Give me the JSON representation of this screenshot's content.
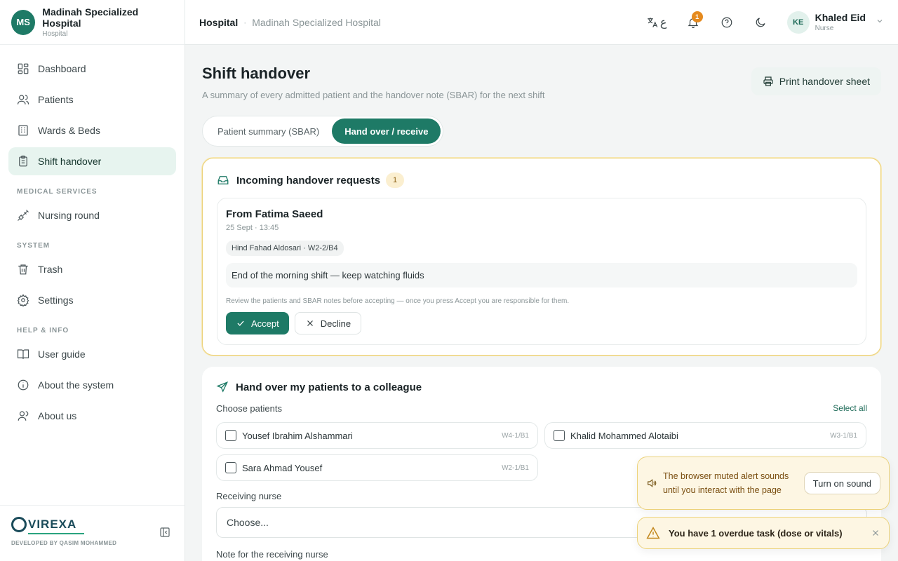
{
  "brand": {
    "initials": "MS",
    "name": "Madinah Specialized Hospital",
    "sub": "Hospital"
  },
  "nav": {
    "main": [
      {
        "label": "Dashboard"
      },
      {
        "label": "Patients"
      },
      {
        "label": "Wards & Beds"
      },
      {
        "label": "Shift handover"
      }
    ],
    "section_medical": "MEDICAL SERVICES",
    "medical": [
      {
        "label": "Nursing round"
      }
    ],
    "section_system": "SYSTEM",
    "system": [
      {
        "label": "Trash"
      },
      {
        "label": "Settings"
      }
    ],
    "section_help": "HELP & INFO",
    "help": [
      {
        "label": "User guide"
      },
      {
        "label": "About the system"
      },
      {
        "label": "About us"
      }
    ]
  },
  "footer": {
    "logo": "VIREXA",
    "developer": "DEVELOPED BY QASIM MOHAMMED"
  },
  "topbar": {
    "crumb_root": "Hospital",
    "crumb_sep": "·",
    "crumb_current": "Madinah Specialized Hospital",
    "lang_glyph": "ع",
    "notif_count": "1",
    "user_initials": "KE",
    "user_name": "Khaled Eid",
    "user_role": "Nurse"
  },
  "page": {
    "title": "Shift handover",
    "subtitle": "A summary of every admitted patient and the handover note (SBAR) for the next shift",
    "print_label": "Print handover sheet",
    "tabs": [
      {
        "label": "Patient summary (SBAR)"
      },
      {
        "label": "Hand over / receive"
      }
    ]
  },
  "incoming": {
    "title": "Incoming handover requests",
    "count": "1",
    "request": {
      "from": "From Fatima Saeed",
      "time": "25 Sept · 13:45",
      "chip": "Hind Fahad Aldosari · W2-2/B4",
      "note": "End of the morning shift — keep watching fluids",
      "hint": "Review the patients and SBAR notes before accepting — once you press Accept you are responsible for them.",
      "accept": "Accept",
      "decline": "Decline"
    }
  },
  "handover": {
    "title": "Hand over my patients to a colleague",
    "choose_label": "Choose patients",
    "select_all": "Select all",
    "patients": [
      {
        "name": "Yousef Ibrahim Alshammari",
        "ward": "W4-1/B1"
      },
      {
        "name": "Khalid Mohammed Alotaibi",
        "ward": "W3-1/B1"
      },
      {
        "name": "Sara Ahmad Yousef",
        "ward": "W2-1/B1"
      }
    ],
    "receiving_label": "Receiving nurse",
    "receiving_placeholder": "Choose...",
    "note_label": "Note for the receiving nurse"
  },
  "toasts": {
    "sound_text": "The browser muted alert sounds until you interact with the page",
    "sound_button": "Turn on sound",
    "overdue_text": "You have 1 overdue task (dose or vitals)"
  }
}
